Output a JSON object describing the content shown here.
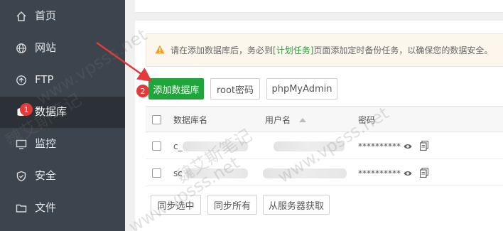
{
  "sidebar": {
    "items": [
      {
        "label": "首页",
        "icon": "home-icon"
      },
      {
        "label": "网站",
        "icon": "globe-icon"
      },
      {
        "label": "FTP",
        "icon": "ftp-icon"
      },
      {
        "label": "数据库",
        "icon": "database-icon",
        "active": true
      },
      {
        "label": "监控",
        "icon": "monitor-icon"
      },
      {
        "label": "安全",
        "icon": "shield-icon"
      },
      {
        "label": "文件",
        "icon": "folder-icon"
      }
    ],
    "badge": "1"
  },
  "notice": {
    "before": "请在添加数据库后，务必到",
    "link": "[计划任务]",
    "after": "页面添加定时备份任务，以确保您的数据安全。"
  },
  "toolbar": {
    "add_label": "添加数据库",
    "root_label": "root密码",
    "pma_label": "phpMyAdmin",
    "badge": "2"
  },
  "table": {
    "headers": {
      "name": "数据库名",
      "user": "用户名",
      "password": "密码"
    },
    "rows": [
      {
        "name_prefix": "c_",
        "password": "**********"
      },
      {
        "name_prefix": "sc",
        "password": "**********"
      }
    ]
  },
  "footer": {
    "sync_selected": "同步选中",
    "sync_all": "同步所有",
    "fetch_server": "从服务器获取"
  },
  "watermark": {
    "text1": "魏艾斯笔记",
    "text2": "www.vpsss.net"
  },
  "colors": {
    "sidebar_bg": "#3c444d",
    "active_bg": "#2b3137",
    "accent": "#20a53a",
    "badge": "#e5393a"
  }
}
